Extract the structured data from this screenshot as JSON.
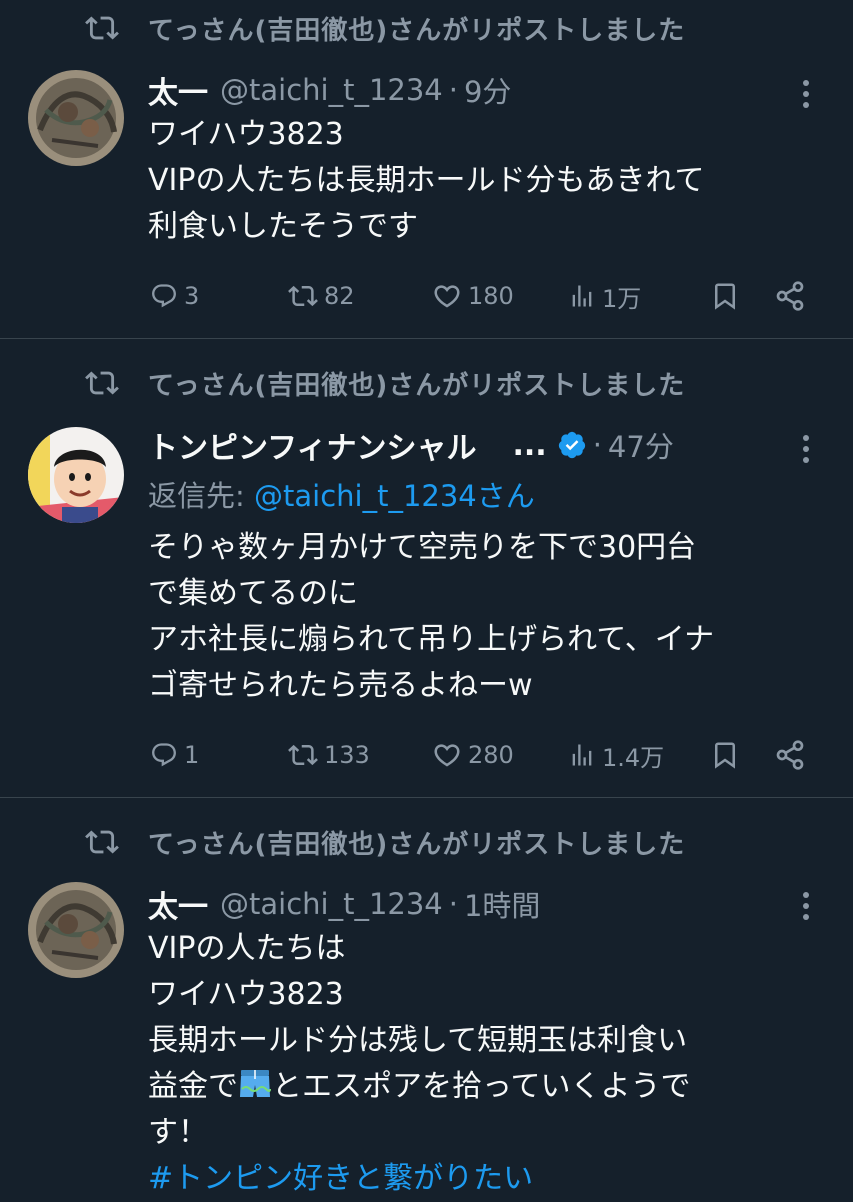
{
  "colors": {
    "background": "#15202b",
    "divider": "#38444d",
    "primary_text": "#f7f9f9",
    "secondary_text": "#8b98a5",
    "link": "#1d9bf0",
    "verified_badge": "#1d9bf0"
  },
  "tweets": [
    {
      "repost_label": "てっさん(吉田徹也)さんがリポストしました",
      "author_name": "太一",
      "handle": "@taichi_t_1234",
      "separator": "·",
      "time": "9分",
      "avatar_icon": "tattooed-back-avatar",
      "lines": [
        "ワイハウ3823",
        "VIPの人たちは長期ホールド分もあきれて",
        "利食いしたそうです"
      ],
      "stats": {
        "replies": "3",
        "reposts": "82",
        "likes": "180",
        "views": "1万"
      }
    },
    {
      "repost_label": "てっさん(吉田徹也)さんがリポストしました",
      "author_name": "トンピンフィナンシャル",
      "name_ellipsis": "...",
      "verified": true,
      "separator": "·",
      "time": "47分",
      "avatar_icon": "cartoon-character-avatar",
      "reply_prefix": "返信先: ",
      "reply_mention": "@taichi_t_1234さん",
      "lines": [
        "そりゃ数ヶ月かけて空売りを下で30円台",
        "で集めてるのに",
        "アホ社長に煽られて吊り上げられて、イナ",
        "ゴ寄せられたら売るよねーw"
      ],
      "stats": {
        "replies": "1",
        "reposts": "133",
        "likes": "280",
        "views": "1.4万"
      }
    },
    {
      "repost_label": "てっさん(吉田徹也)さんがリポストしました",
      "author_name": "太一",
      "handle": "@taichi_t_1234",
      "separator": "·",
      "time": "1時間",
      "avatar_icon": "tattooed-back-avatar",
      "lines": [
        "VIPの人たちは",
        "ワイハウ3823",
        "長期ホールド分は残して短期玉は利食い",
        "とエスポアを拾っていくようで",
        "す！"
      ],
      "line5_prefix": "益金で",
      "emoji_icon": "swim-shorts-emoji",
      "hashtag": "#トンピン好きと繋がりたい"
    }
  ]
}
